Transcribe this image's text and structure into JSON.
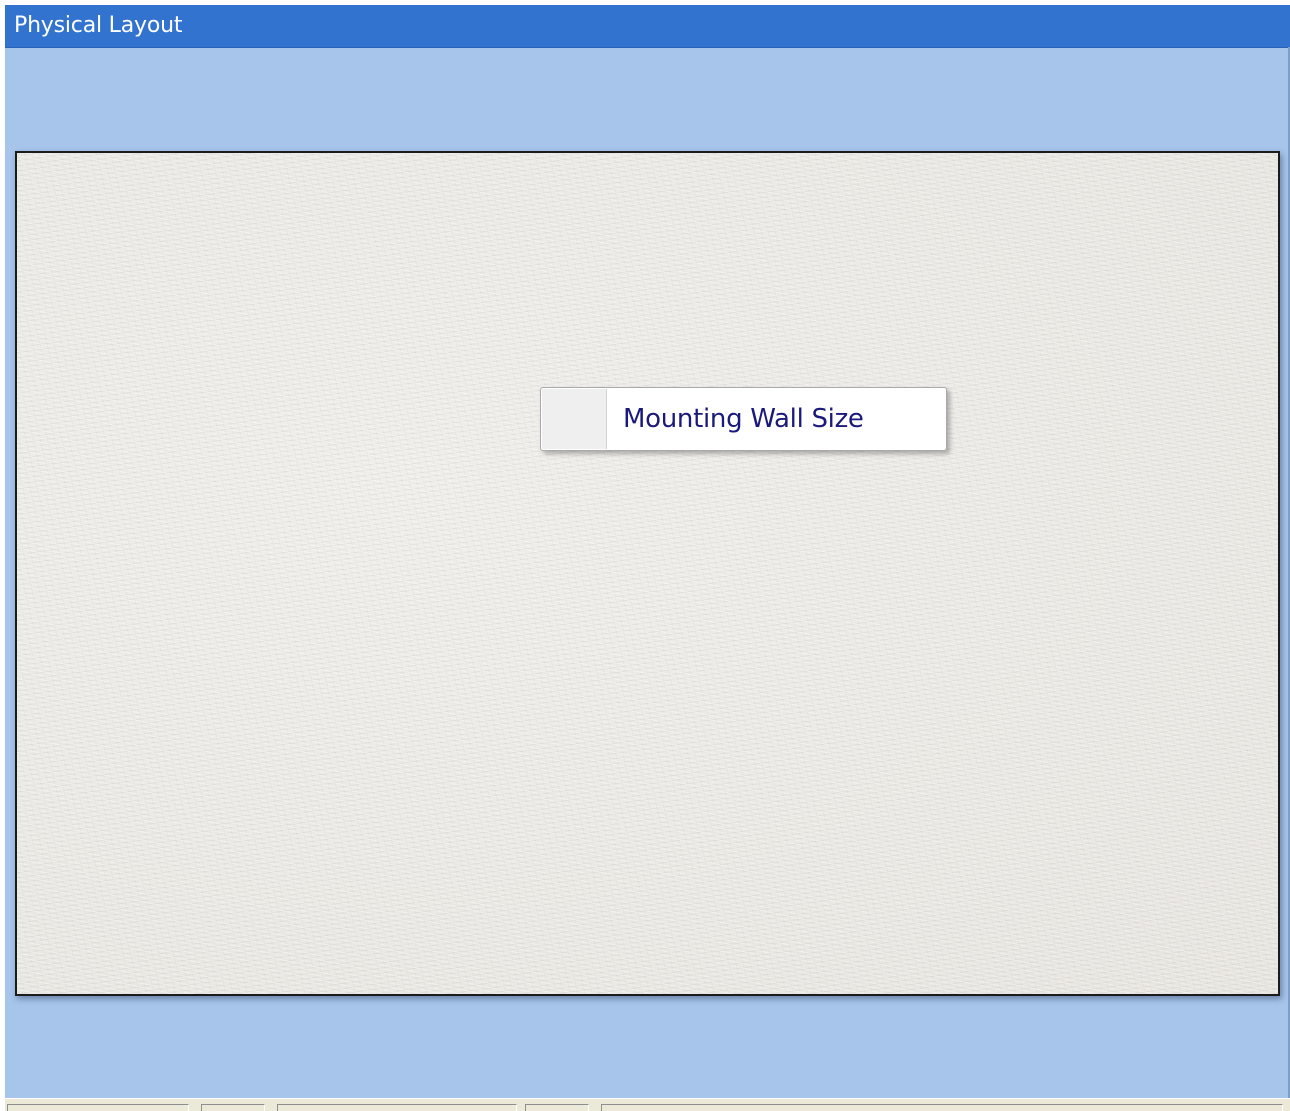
{
  "window": {
    "title": "Physical Layout",
    "titlebar_color": "#3273d0",
    "background_color": "#a7c5ea"
  },
  "canvas": {
    "texture": "stucco-wall"
  },
  "context_menu": {
    "items": [
      {
        "label": "Mounting Wall Size"
      }
    ]
  },
  "statusbar": {
    "panels": [
      "",
      "",
      "",
      "",
      ""
    ]
  }
}
